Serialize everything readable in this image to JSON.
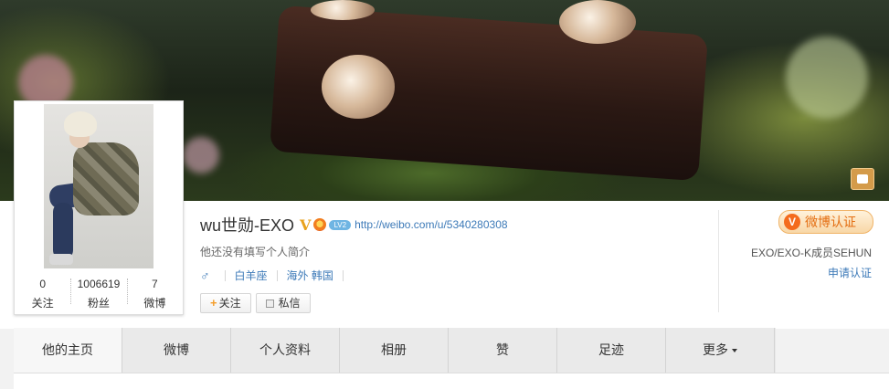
{
  "profile": {
    "name": "wu世勋-EXO",
    "badge_v": "V",
    "level": "LV2",
    "url": "http://weibo.com/u/5340280308",
    "bio": "他还没有填写个人简介",
    "gender_icon": "male-icon",
    "zodiac": "白羊座",
    "location": "海外 韩国",
    "follow_button": "关注",
    "message_button": "私信"
  },
  "stats": [
    {
      "value": "0",
      "label": "关注"
    },
    {
      "value": "1006619",
      "label": "粉丝"
    },
    {
      "value": "7",
      "label": "微博"
    }
  ],
  "verification": {
    "badge_label": "微博认证",
    "badge_icon_glyph": "V",
    "description": "EXO/EXO-K成员SEHUN",
    "apply_link": "申请认证"
  },
  "nav": {
    "tabs": [
      "他的主页",
      "微博",
      "个人资料",
      "相册",
      "赞",
      "足迹"
    ],
    "more": "更多",
    "active_index": 0
  },
  "colors": {
    "link": "#3d7ab8",
    "verify_orange": "#e46f13",
    "follow_plus": "#f49d2a"
  }
}
